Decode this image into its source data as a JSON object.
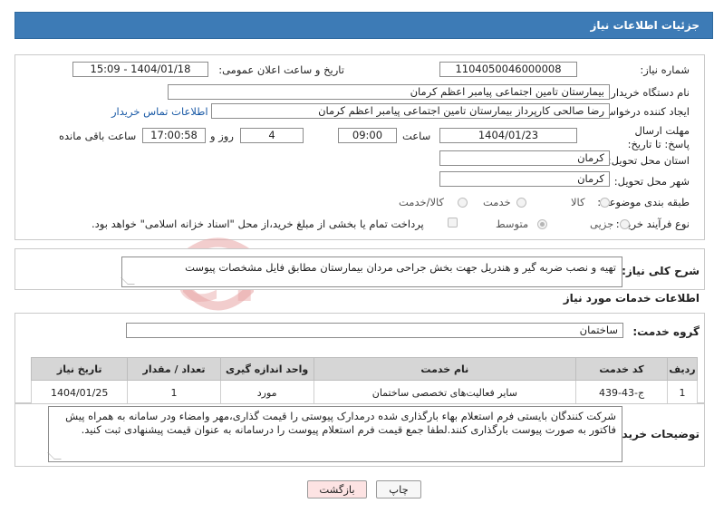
{
  "header": {
    "title": "جزئیات اطلاعات نیاز"
  },
  "form": {
    "need_number_label": "شماره نیاز:",
    "need_number": "1104050046000008",
    "announce_label": "تاریخ و ساعت اعلان عمومی:",
    "announce_value": "1404/01/18 - 15:09",
    "buyer_org_label": "نام دستگاه خریدار:",
    "buyer_org": "بیمارستان تامین اجتماعی پیامبر اعظم کرمان",
    "creator_label": "ایجاد کننده درخواست:",
    "creator": "رضا صالحی  کارپرداز بیمارستان تامین اجتماعی پیامبر اعظم کرمان",
    "contact_link": "اطلاعات تماس خریدار",
    "deadline_label": "مهلت ارسال پاسخ: تا تاریخ:",
    "deadline_date": "1404/01/23",
    "time_label": "ساعت",
    "deadline_time": "09:00",
    "days_value": "4",
    "days_label": "روز و",
    "remaining_time": "17:00:58",
    "remaining_label": "ساعت باقی مانده",
    "province_label": "استان محل تحویل:",
    "province": "کرمان",
    "city_label": "شهر محل تحویل:",
    "city": "کرمان",
    "category_label": "طبقه بندی موضوعی:",
    "category_options": [
      "کالا",
      "خدمت",
      "کالا/خدمت"
    ],
    "category_selected": "خدمت",
    "process_label": "نوع فرآیند خرید :",
    "process_options": [
      "جزیی",
      "متوسط"
    ],
    "process_selected": "جزیی",
    "payment_note": "پرداخت تمام یا بخشی از مبلغ خرید،از محل \"اسناد خزانه اسلامی\" خواهد بود."
  },
  "description": {
    "label": "شرح کلی نیاز:",
    "text": "تهیه و نصب ضربه گیر و هندریل جهت بخش جراحی مردان بیمارستان مطابق فایل مشخصات پیوست"
  },
  "services": {
    "title": "اطلاعات خدمات مورد نیاز",
    "group_label": "گروه خدمت:",
    "group_value": "ساختمان",
    "columns": [
      "ردیف",
      "کد خدمت",
      "نام خدمت",
      "واحد اندازه گیری",
      "تعداد / مقدار",
      "تاریخ نیاز"
    ],
    "rows": [
      [
        "1",
        "ج-43-439",
        "سایر فعالیت‌های تخصصی ساختمان",
        "مورد",
        "1",
        "1404/01/25"
      ]
    ]
  },
  "buyer_notes": {
    "label": "توضیحات خریدار:",
    "text": "شرکت کنندگان بایستی فرم استعلام بهاء بارگذاری شده درمدارک پیوستی را قیمت گذاری،مهر وامضاء ودر سامانه به همراه پیش فاکتور به صورت پیوست بارگذاری کنند.لطفا جمع قیمت فرم استعلام پیوست را درسامانه به عنوان قیمت پیشنهادی ثبت کنید."
  },
  "buttons": {
    "print": "چاپ",
    "back": "بازگشت"
  },
  "watermark": {
    "text": "AriaTender.neT"
  },
  "colors": {
    "header_bg": "#3d7bb6",
    "link": "#1a5aa6",
    "back_bg": "#fde3e3",
    "watermark": "#e8a4a4"
  }
}
